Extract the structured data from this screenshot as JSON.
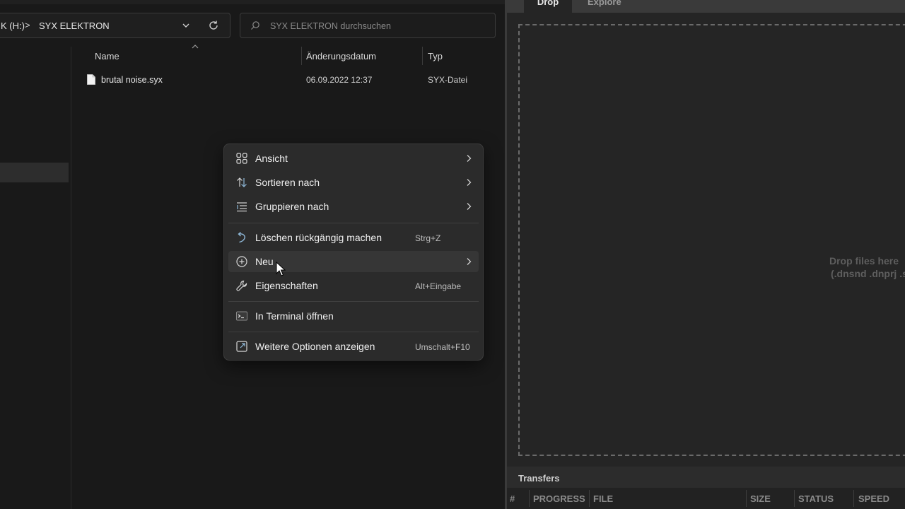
{
  "explorer": {
    "address": {
      "drive_label": "K (H:)",
      "separator": ">",
      "folder_label": "SYX ELEKTRON"
    },
    "search": {
      "placeholder": "SYX ELEKTRON durchsuchen"
    },
    "columns": {
      "name": "Name",
      "date": "Änderungsdatum",
      "type": "Typ"
    },
    "files": [
      {
        "name": "brutal noise.syx",
        "date": "06.09.2022 12:37",
        "type": "SYX-Datei",
        "icon": "document-icon"
      }
    ]
  },
  "context_menu": {
    "items": [
      {
        "label": "Ansicht",
        "icon": "grid-view-icon",
        "submenu": true
      },
      {
        "label": "Sortieren nach",
        "icon": "sort-icon",
        "submenu": true
      },
      {
        "label": "Gruppieren nach",
        "icon": "group-list-icon",
        "submenu": true
      },
      {
        "label": "Löschen rückgängig machen",
        "icon": "undo-icon",
        "shortcut": "Strg+Z"
      },
      {
        "label": "Neu",
        "icon": "add-circle-icon",
        "submenu": true,
        "hovered": true
      },
      {
        "label": "Eigenschaften",
        "icon": "wrench-icon",
        "shortcut": "Alt+Eingabe"
      },
      {
        "label": "In  Terminal öffnen",
        "icon": "terminal-icon"
      },
      {
        "label": "Weitere Optionen anzeigen",
        "icon": "open-external-icon",
        "shortcut": "Umschalt+F10"
      }
    ]
  },
  "app": {
    "tabs": {
      "drop": "Drop",
      "explore": "Explore"
    },
    "dropzone": {
      "title": "Drop files here",
      "subtitle": "(.dnsnd .dnprj .syx"
    },
    "transfers": {
      "title": "Transfers",
      "columns": [
        "#",
        "PROGRESS",
        "FILE",
        "SIZE",
        "STATUS",
        "SPEED"
      ]
    }
  },
  "colors": {
    "explorer_bg": "#191919",
    "menu_bg": "#2b2b2b",
    "accent_icon": "#8fb8d8"
  }
}
